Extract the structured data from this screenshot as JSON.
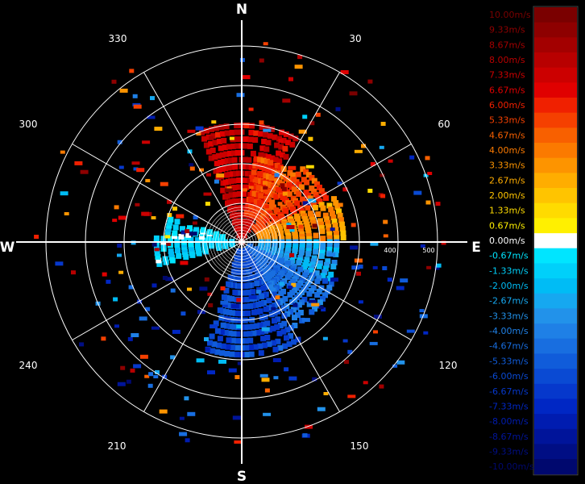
{
  "chart_data": {
    "type": "polar_radar_velocity",
    "compass": [
      "N",
      "E",
      "S",
      "W"
    ],
    "bearings": [
      "30",
      "60",
      "120",
      "150",
      "210",
      "240",
      "300",
      "330"
    ],
    "range_labels": [
      "400",
      "500"
    ],
    "colorbar": {
      "labels": [
        "10.00m/s",
        "9.33m/s",
        "8.67m/s",
        "8.00m/s",
        "7.33m/s",
        "6.67m/s",
        "6.00m/s",
        "5.33m/s",
        "4.67m/s",
        "4.00m/s",
        "3.33m/s",
        "2.67m/s",
        "2.00m/s",
        "1.33m/s",
        "0.67m/s",
        "0.00m/s",
        "-0.67m/s",
        "-1.33m/s",
        "-2.00m/s",
        "-2.67m/s",
        "-3.33m/s",
        "-4.00m/s",
        "-4.67m/s",
        "-5.33m/s",
        "-6.00m/s",
        "-6.67m/s",
        "-7.33m/s",
        "-8.00m/s",
        "-8.67m/s",
        "-9.33m/s",
        "-10.00m/s"
      ],
      "colors": [
        "#7a0000",
        "#8e0000",
        "#a30000",
        "#b80000",
        "#cc0000",
        "#e00000",
        "#f02000",
        "#f54000",
        "#f86000",
        "#fb7a00",
        "#fd9400",
        "#ffad00",
        "#ffc400",
        "#ffdb00",
        "#fff000",
        "#ffffff",
        "#00e5ff",
        "#00d0fa",
        "#00bcf5",
        "#16a8f0",
        "#2292ea",
        "#1f80e6",
        "#186ee0",
        "#105cda",
        "#0a4ad3",
        "#0638cc",
        "#0027c4",
        "#001cb0",
        "#00149a",
        "#000e84",
        "#00086e"
      ]
    },
    "velocity_sectors": [
      {
        "from_deg": 340,
        "to_deg": 30,
        "range_from": 0,
        "range_to": 0.63,
        "velocity": 7.3
      },
      {
        "from_deg": 10,
        "to_deg": 40,
        "range_from": 0.15,
        "range_to": 0.45,
        "velocity": 5.3
      },
      {
        "from_deg": 40,
        "to_deg": 65,
        "range_from": 0.1,
        "range_to": 0.5,
        "velocity": 5.3
      },
      {
        "from_deg": 65,
        "to_deg": 90,
        "range_from": 0.1,
        "range_to": 0.55,
        "velocity": 3.3
      },
      {
        "from_deg": 90,
        "to_deg": 115,
        "range_from": 0.1,
        "range_to": 0.5,
        "velocity": -2.7
      },
      {
        "from_deg": 115,
        "to_deg": 150,
        "range_from": 0.05,
        "range_to": 0.52,
        "velocity": -4.7
      },
      {
        "from_deg": 150,
        "to_deg": 200,
        "range_from": 0.05,
        "range_to": 0.58,
        "velocity": -6.0
      },
      {
        "from_deg": 255,
        "to_deg": 275,
        "range_from": 0.05,
        "range_to": 0.45,
        "velocity": -1.3
      },
      {
        "from_deg": 275,
        "to_deg": 290,
        "range_from": 0.1,
        "range_to": 0.4,
        "velocity": -0.7
      }
    ]
  }
}
